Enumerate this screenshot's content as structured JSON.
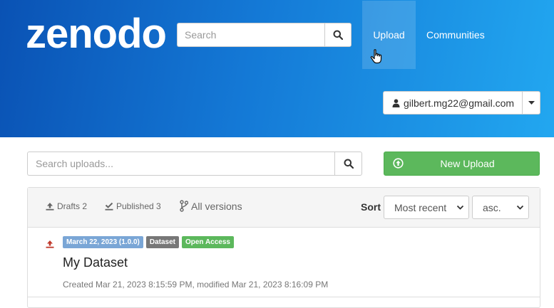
{
  "header": {
    "logo": "zenodo",
    "search_placeholder": "Search",
    "nav": {
      "upload": "Upload",
      "communities": "Communities"
    },
    "user_email": "gilbert.mg22@gmail.com"
  },
  "uploads": {
    "search_placeholder": "Search uploads...",
    "new_upload_label": "New Upload",
    "tabs": {
      "drafts": "Drafts 2",
      "published": "Published 3",
      "versions": "All versions"
    },
    "sort_label": "Sort",
    "sort_value": "Most recent",
    "order_value": "asc."
  },
  "records": [
    {
      "date_badge": "March 22, 2023 (1.0.0)",
      "type_badge": "Dataset",
      "access_badge": "Open Access",
      "title": "My Dataset",
      "meta": "Created Mar 21, 2023 8:15:59 PM, modified Mar 21, 2023 8:16:09 PM"
    }
  ],
  "colors": {
    "header_start": "#0a52b4",
    "header_end": "#22a7f0",
    "success": "#5cb85c",
    "badge_date": "#7aa6d6",
    "badge_type": "#777777",
    "upload_icon": "#c0392b"
  }
}
